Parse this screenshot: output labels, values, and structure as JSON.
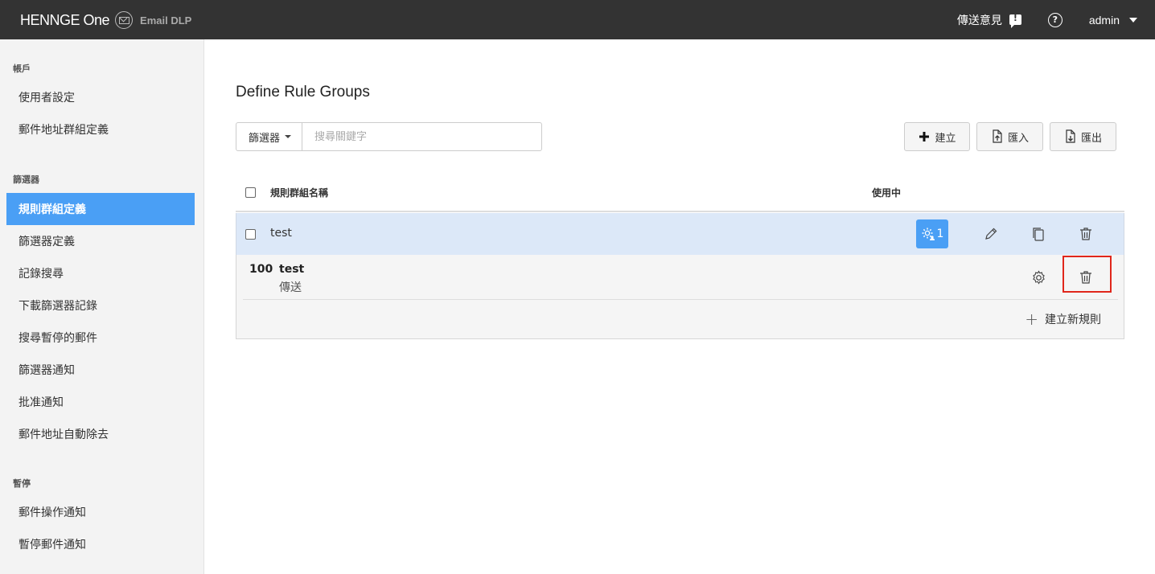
{
  "header": {
    "brand_logo": "HENNGE One",
    "brand_icon": "mail-circle-icon",
    "product": "Email DLP",
    "feedback_label": "傳送意見",
    "feedback_icon": "feedback-icon",
    "help_icon": "help-circle-icon",
    "user": "admin",
    "user_menu_icon": "caret-down-icon"
  },
  "sidebar": {
    "sections": [
      {
        "heading": "帳戶",
        "items": [
          "使用者設定",
          "郵件地址群組定義"
        ]
      },
      {
        "heading": "篩選器",
        "items": [
          "規則群組定義",
          "篩選器定義",
          "記錄搜尋",
          "下載篩選器記錄",
          "搜尋暫停的郵件",
          "篩選器通知",
          "批准通知",
          "郵件地址自動除去"
        ]
      },
      {
        "heading": "暫停",
        "items": [
          "郵件操作通知",
          "暫停郵件通知"
        ]
      }
    ],
    "active_item": "規則群組定義"
  },
  "main": {
    "title": "Define Rule Groups",
    "filter_label": "篩選器",
    "search_placeholder": "搜尋關鍵字",
    "buttons": {
      "create": "建立",
      "import": "匯入",
      "export": "匯出"
    },
    "table": {
      "columns": [
        "規則群組名稱",
        "使用中"
      ],
      "groups": [
        {
          "name": "test",
          "in_use_count": "1",
          "rules": [
            {
              "priority": "100",
              "name": "test",
              "action": "傳送"
            }
          ],
          "add_rule_label": "建立新規則"
        }
      ]
    }
  },
  "colors": {
    "topbar": "#333333",
    "accent": "#4a9ff5",
    "group_row": "#dce8f8",
    "highlight": "#e0261b"
  }
}
